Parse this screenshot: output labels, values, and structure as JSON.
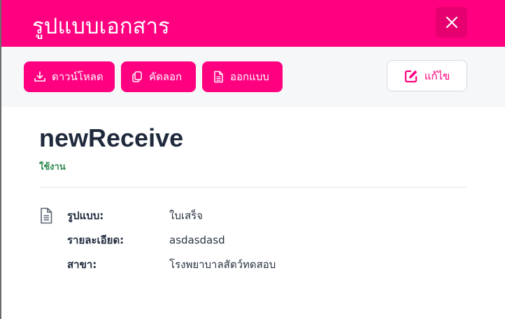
{
  "header": {
    "title": "รูปแบบเอกสาร",
    "close_icon": "close-icon"
  },
  "toolbar": {
    "download_label": "ดาวน์โหลด",
    "copy_label": "คัดลอก",
    "design_label": "ออกแบบ",
    "edit_label": "แก้ไข"
  },
  "template": {
    "name": "newReceive",
    "status": "ใช้งาน",
    "details": [
      {
        "label": "รูปแบบ:",
        "value": "ใบเสร็จ"
      },
      {
        "label": "รายละเอียด:",
        "value": "asdasdasd"
      },
      {
        "label": "สาขา:",
        "value": "โรงพยาบาลสัตว์ทดสอบ"
      }
    ]
  },
  "colors": {
    "accent": "#ff0080",
    "status": "#2e8a4e",
    "title": "#1f2a3c"
  }
}
